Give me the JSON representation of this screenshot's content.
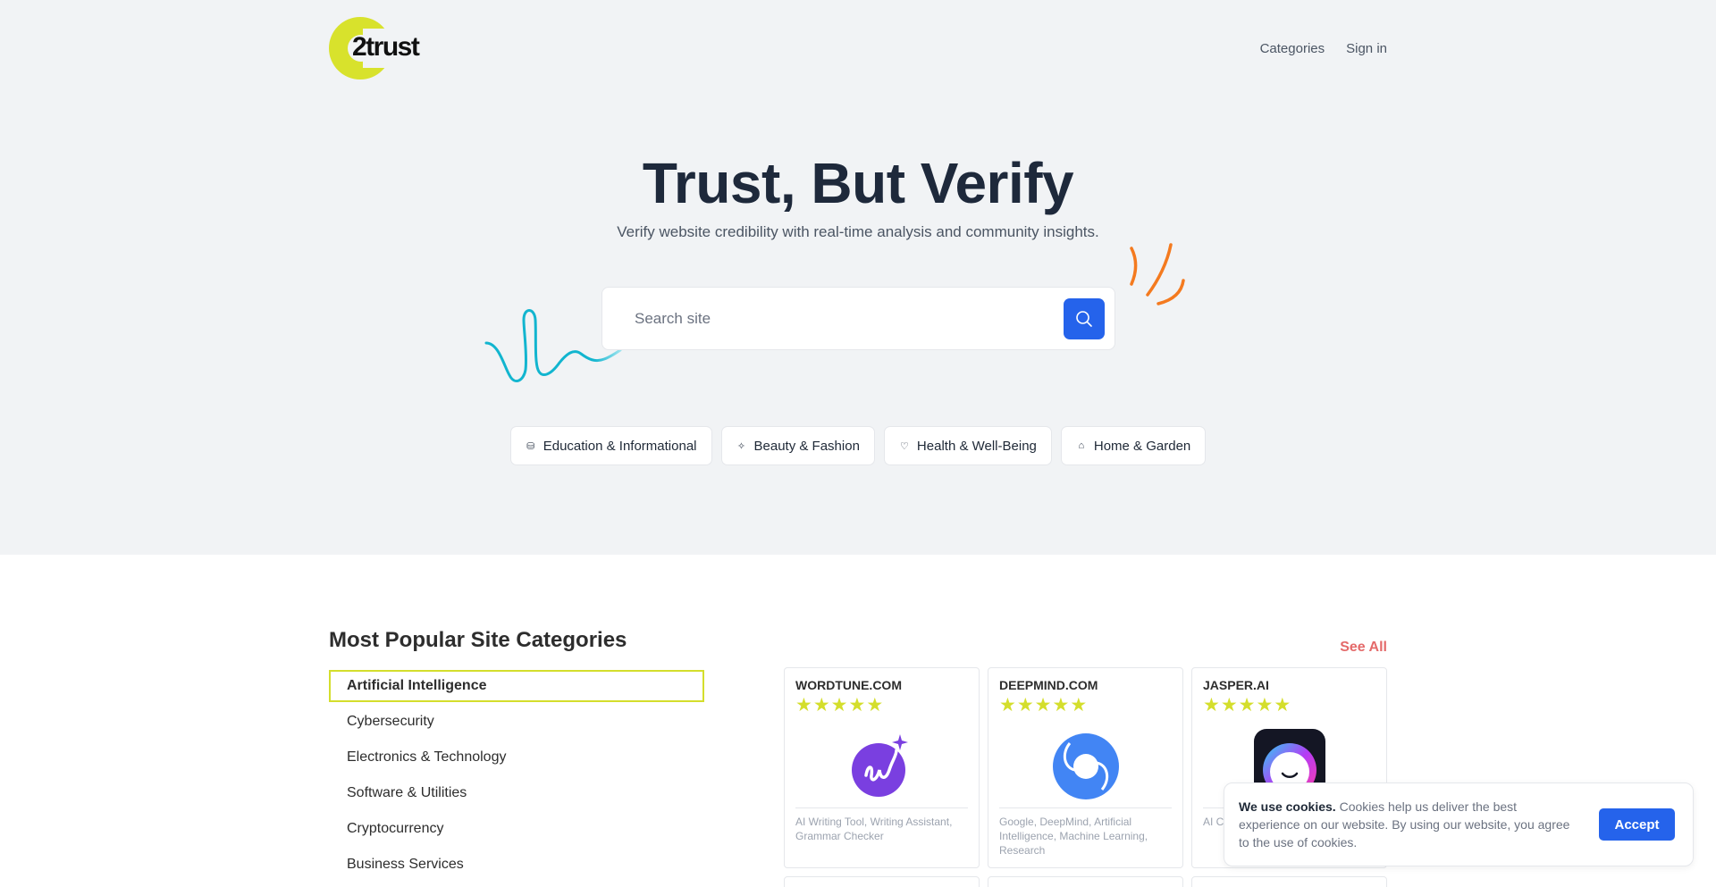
{
  "brand": {
    "logo_text": "2trust",
    "accent": "#d8e22c"
  },
  "nav": {
    "categories": "Categories",
    "signin": "Sign in"
  },
  "hero": {
    "title": "Trust, But Verify",
    "subtitle": "Verify website credibility with real-time analysis and community insights.",
    "search": {
      "placeholder": "Search site",
      "value": ""
    },
    "chips": [
      {
        "icon": "graduation-cap-icon",
        "label": "Education & Informational"
      },
      {
        "icon": "sparkles-icon",
        "label": "Beauty & Fashion"
      },
      {
        "icon": "heart-icon",
        "label": "Health & Well-Being"
      },
      {
        "icon": "home-icon",
        "label": "Home & Garden"
      }
    ]
  },
  "popular": {
    "title": "Most Popular Site Categories",
    "see_all": "See All",
    "categories": [
      {
        "label": "Artificial Intelligence",
        "active": true
      },
      {
        "label": "Cybersecurity",
        "active": false
      },
      {
        "label": "Electronics & Technology",
        "active": false
      },
      {
        "label": "Software & Utilities",
        "active": false
      },
      {
        "label": "Cryptocurrency",
        "active": false
      },
      {
        "label": "Business Services",
        "active": false
      }
    ],
    "sites": [
      {
        "name": "WORDTUNE.COM",
        "rating": 5,
        "max_rating": 5,
        "logo": "wordtune-logo",
        "tags": "AI Writing Tool, Writing Assistant, Grammar Checker"
      },
      {
        "name": "DEEPMIND.COM",
        "rating": 5,
        "max_rating": 5,
        "logo": "deepmind-logo",
        "tags": "Google, DeepMind, Artificial Intelligence, Machine Learning, Research"
      },
      {
        "name": "JASPER.AI",
        "rating": 5,
        "max_rating": 5,
        "logo": "jasper-logo",
        "tags": "AI C… Lang… Mar…"
      }
    ]
  },
  "cookie": {
    "bold": "We use cookies.",
    "text": " Cookies help us deliver the best experience on our website. By using our website, you agree to the use of cookies.",
    "accept": "Accept"
  }
}
